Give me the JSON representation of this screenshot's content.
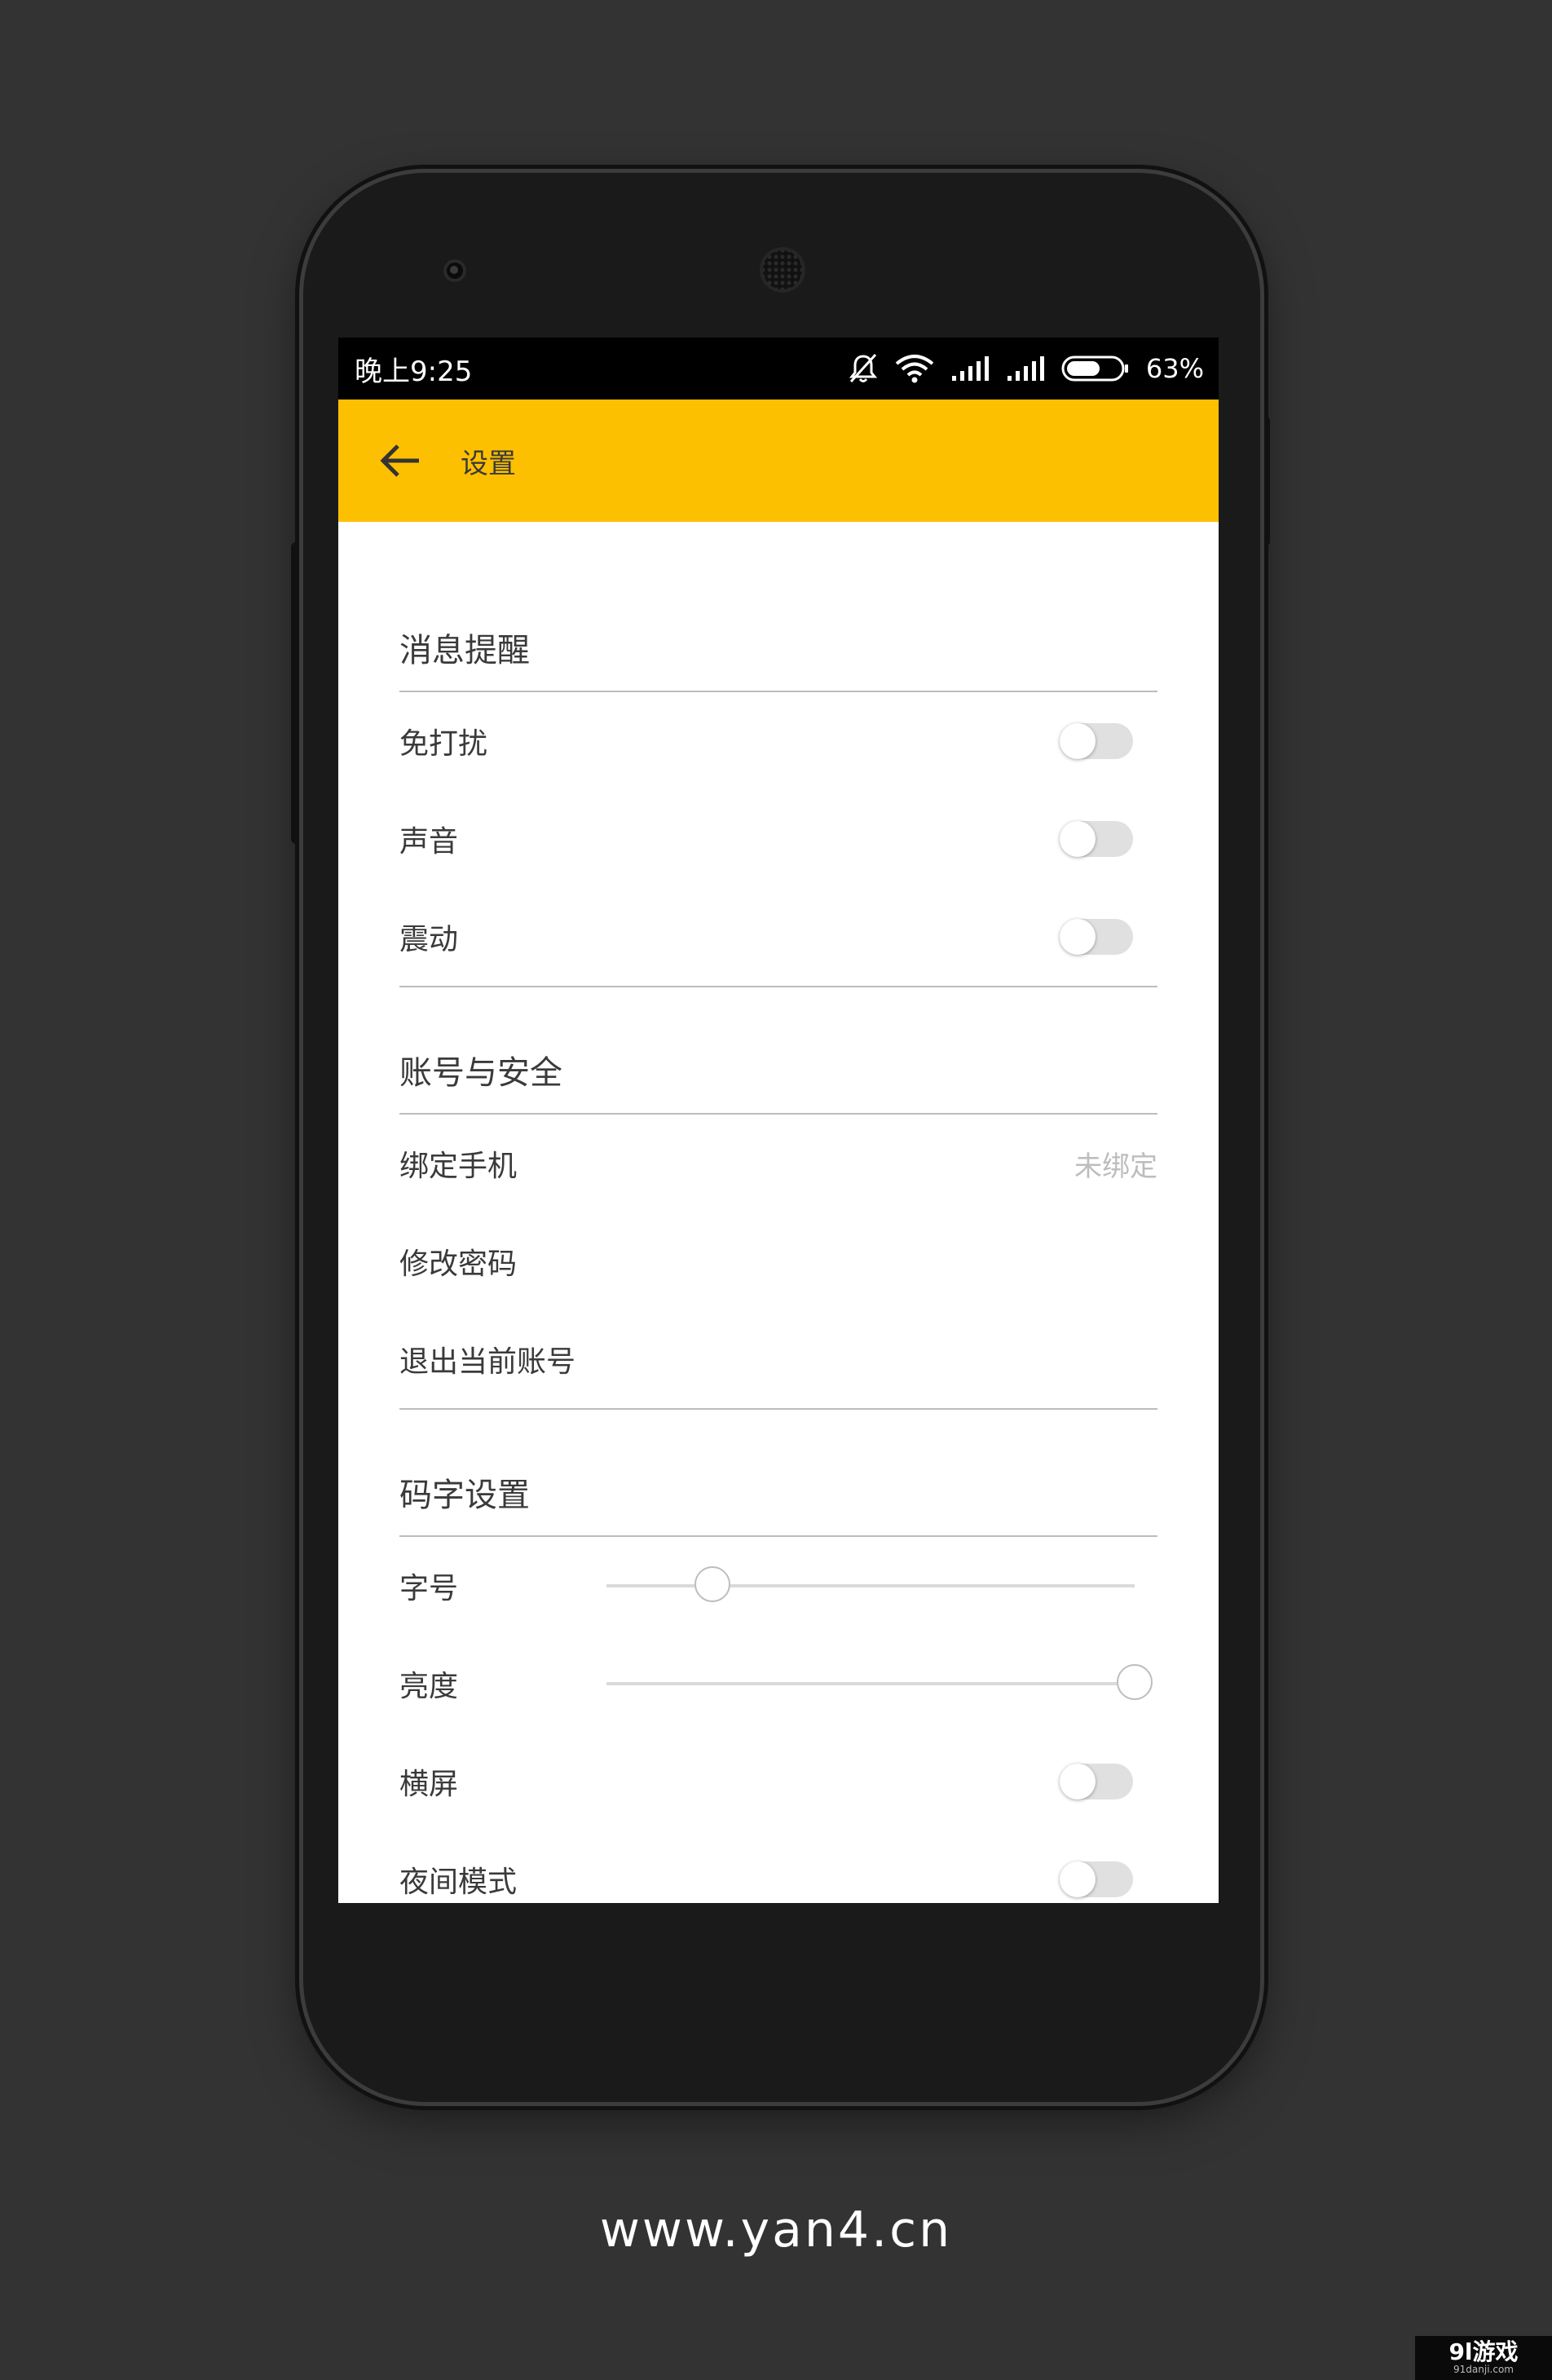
{
  "status_bar": {
    "time": "晚上9:25",
    "battery_percent": "63%",
    "battery_level": 0.63,
    "icons": [
      "bell-off-icon",
      "wifi-icon",
      "signal-icon",
      "signal-icon",
      "battery-icon"
    ]
  },
  "toolbar": {
    "back_icon": "arrow-left-icon",
    "title": "设置",
    "color": "#fdc000"
  },
  "sections": {
    "notifications": {
      "title": "消息提醒",
      "items": [
        {
          "label": "免打扰",
          "type": "toggle",
          "on": false
        },
        {
          "label": "声音",
          "type": "toggle",
          "on": false
        },
        {
          "label": "震动",
          "type": "toggle",
          "on": false
        }
      ]
    },
    "account": {
      "title": "账号与安全",
      "items": [
        {
          "label": "绑定手机",
          "value": "未绑定"
        },
        {
          "label": "修改密码"
        },
        {
          "label": "退出当前账号"
        }
      ]
    },
    "typing": {
      "title": "码字设置",
      "items": [
        {
          "label": "字号",
          "type": "slider",
          "value": 0.2
        },
        {
          "label": "亮度",
          "type": "slider",
          "value": 1.0
        },
        {
          "label": "横屏",
          "type": "toggle",
          "on": false
        },
        {
          "label": "夜间模式",
          "type": "toggle",
          "on": false
        }
      ]
    }
  },
  "footer": {
    "url": "www.yan4.cn"
  },
  "watermark": {
    "main": "9l游戏",
    "sub": "91danji.com"
  }
}
